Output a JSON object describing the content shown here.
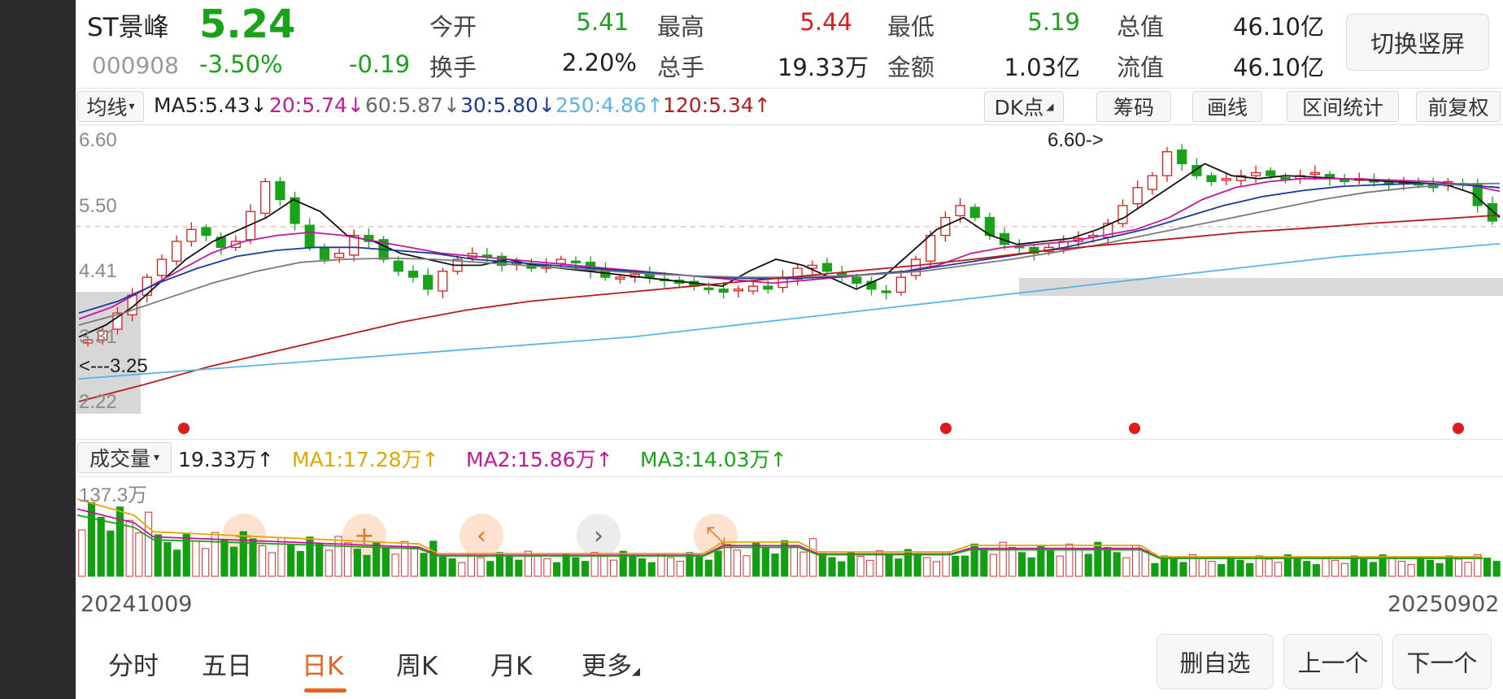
{
  "quote": {
    "name": "ST景峰",
    "code": "000908",
    "price": "5.24",
    "change_pct": "-3.50%",
    "change": "-0.19",
    "stats": [
      {
        "label": "今开",
        "value": "5.41",
        "color": "#1aa31a"
      },
      {
        "label": "最高",
        "value": "5.44",
        "color": "#e01b1b"
      },
      {
        "label": "最低",
        "value": "5.19",
        "color": "#1aa31a"
      },
      {
        "label": "总值",
        "value": "46.10亿",
        "color": "#222222"
      },
      {
        "label": "换手",
        "value": "2.20%",
        "color": "#222222"
      },
      {
        "label": "总手",
        "value": "19.33万",
        "color": "#222222"
      },
      {
        "label": "金额",
        "value": "1.03亿",
        "color": "#222222"
      },
      {
        "label": "流值",
        "value": "46.10亿",
        "color": "#222222"
      }
    ],
    "switch_button": "切换竖屏"
  },
  "indicator_bar": {
    "selector": "均线",
    "ma": [
      {
        "text": "MA5:5.43",
        "arrow": "↓",
        "color": "#222222"
      },
      {
        "text": "20:5.74",
        "arrow": "↓",
        "color": "#c2189a"
      },
      {
        "text": "60:5.87",
        "arrow": "↓",
        "color": "#666666"
      },
      {
        "text": "30:5.80",
        "arrow": "↓",
        "color": "#1a3a9a"
      },
      {
        "text": "250:4.86",
        "arrow": "↑",
        "color": "#5ab4e6"
      },
      {
        "text": "120:5.34",
        "arrow": "↑",
        "color": "#b71c1c"
      }
    ],
    "buttons": [
      "DK点",
      "筹码",
      "画线",
      "区间统计",
      "前复权"
    ]
  },
  "chart_data": {
    "type": "candlestick",
    "y_axis_labels": [
      "6.60",
      "5.50",
      "4.41",
      "3.31",
      "2.22"
    ],
    "ylim": [
      2.22,
      6.6
    ],
    "max_annotation": "6.60->",
    "min_annotation": "<---3.25",
    "start_date": "20241009",
    "end_date": "20250902",
    "close_series": [
      3.25,
      3.4,
      3.7,
      4.0,
      4.3,
      4.6,
      4.9,
      5.1,
      5.0,
      4.8,
      4.9,
      5.4,
      5.9,
      5.6,
      5.2,
      4.8,
      4.6,
      4.7,
      5.0,
      4.9,
      4.6,
      4.4,
      4.3,
      4.1,
      4.4,
      4.6,
      4.7,
      4.65,
      4.5,
      4.55,
      4.45,
      4.5,
      4.6,
      4.55,
      4.4,
      4.3,
      4.3,
      4.35,
      4.3,
      4.25,
      4.2,
      4.15,
      4.1,
      4.05,
      4.1,
      4.15,
      4.1,
      4.3,
      4.45,
      4.5,
      4.4,
      4.3,
      4.2,
      4.1,
      4.05,
      4.3,
      4.6,
      5.0,
      5.3,
      5.5,
      5.3,
      5.0,
      4.85,
      4.8,
      4.7,
      4.8,
      4.9,
      4.95,
      5.0,
      5.2,
      5.5,
      5.8,
      6.0,
      6.4,
      6.2,
      6.0,
      5.9,
      5.95,
      6.0,
      6.05,
      6.0,
      5.95,
      6.0,
      6.05,
      5.95,
      5.9,
      5.95,
      5.9,
      5.85,
      5.9,
      5.85,
      5.8,
      5.9,
      5.85,
      5.5,
      5.24
    ],
    "ma_series": [
      {
        "name": "MA5",
        "color": "#111111",
        "values": [
          3.3,
          3.5,
          3.8,
          4.2,
          4.6,
          4.9,
          5.1,
          5.3,
          5.6,
          5.4,
          5.0,
          4.9,
          4.7,
          4.6,
          4.5,
          4.5,
          4.6,
          4.5,
          4.45,
          4.4,
          4.35,
          4.3,
          4.25,
          4.2,
          4.15,
          4.4,
          4.6,
          4.5,
          4.3,
          4.1,
          4.3,
          4.7,
          5.1,
          5.3,
          5.0,
          4.85,
          4.9,
          4.95,
          5.1,
          5.3,
          5.6,
          5.9,
          6.2,
          6.0,
          5.95,
          6.0,
          5.98,
          5.95,
          5.93,
          5.9,
          5.88,
          5.85,
          5.7,
          5.3
        ]
      },
      {
        "name": "MA20",
        "color": "#c2189a",
        "values": [
          3.6,
          3.8,
          4.1,
          4.4,
          4.7,
          4.9,
          5.0,
          5.05,
          5.0,
          4.9,
          4.8,
          4.7,
          4.65,
          4.6,
          4.55,
          4.5,
          4.45,
          4.4,
          4.35,
          4.3,
          4.25,
          4.2,
          4.25,
          4.3,
          4.35,
          4.4,
          4.5,
          4.7,
          4.8,
          4.85,
          4.9,
          5.0,
          5.1,
          5.3,
          5.6,
          5.8,
          5.9,
          5.95,
          5.95,
          5.94,
          5.92,
          5.9,
          5.85,
          5.74
        ]
      },
      {
        "name": "MA30",
        "color": "#1a3a9a",
        "values": [
          3.7,
          3.9,
          4.2,
          4.45,
          4.65,
          4.75,
          4.8,
          4.8,
          4.75,
          4.7,
          4.6,
          4.55,
          4.5,
          4.45,
          4.4,
          4.35,
          4.3,
          4.28,
          4.28,
          4.3,
          4.35,
          4.4,
          4.5,
          4.6,
          4.7,
          4.8,
          4.95,
          5.1,
          5.3,
          5.5,
          5.65,
          5.75,
          5.82,
          5.85,
          5.87,
          5.85,
          5.8
        ]
      },
      {
        "name": "MA60",
        "color": "#7a7a7a",
        "values": [
          3.5,
          3.7,
          3.95,
          4.2,
          4.4,
          4.55,
          4.6,
          4.62,
          4.6,
          4.55,
          4.5,
          4.45,
          4.4,
          4.35,
          4.32,
          4.3,
          4.3,
          4.32,
          4.35,
          4.4,
          4.5,
          4.6,
          4.72,
          4.85,
          5.0,
          5.15,
          5.3,
          5.45,
          5.6,
          5.72,
          5.8,
          5.86,
          5.87
        ]
      },
      {
        "name": "MA120",
        "color": "#b71c1c",
        "values": [
          2.22,
          2.5,
          2.8,
          3.05,
          3.3,
          3.55,
          3.75,
          3.9,
          4.0,
          4.1,
          4.2,
          4.3,
          4.4,
          4.5,
          4.62,
          4.75,
          4.85,
          4.95,
          5.05,
          5.12,
          5.2,
          5.27,
          5.34
        ]
      },
      {
        "name": "MA250",
        "color": "#5ab4e6",
        "values": [
          2.6,
          2.7,
          2.8,
          2.9,
          3.0,
          3.1,
          3.2,
          3.3,
          3.45,
          3.6,
          3.75,
          3.9,
          4.05,
          4.2,
          4.35,
          4.5,
          4.65,
          4.75,
          4.86
        ]
      }
    ]
  },
  "volume": {
    "selector": "成交量",
    "current": "19.33万",
    "current_arrow": "↑",
    "ma": [
      {
        "text": "MA1:17.28万",
        "arrow": "↑",
        "color": "#e0a800"
      },
      {
        "text": "MA2:15.86万",
        "arrow": "↑",
        "color": "#c2189a"
      },
      {
        "text": "MA3:14.03万",
        "arrow": "↑",
        "color": "#1aa31a"
      }
    ],
    "max_label": "137.3万"
  },
  "dates": {
    "start": "20241009",
    "end": "20250902"
  },
  "tabs": [
    "分时",
    "五日",
    "日K",
    "周K",
    "月K",
    "更多"
  ],
  "active_tab": "日K",
  "actions": [
    "删自选",
    "上一个",
    "下一个"
  ],
  "nav": {
    "minus": "−",
    "plus": "+",
    "prev": "‹",
    "next": "›",
    "shrink": "⤡"
  }
}
